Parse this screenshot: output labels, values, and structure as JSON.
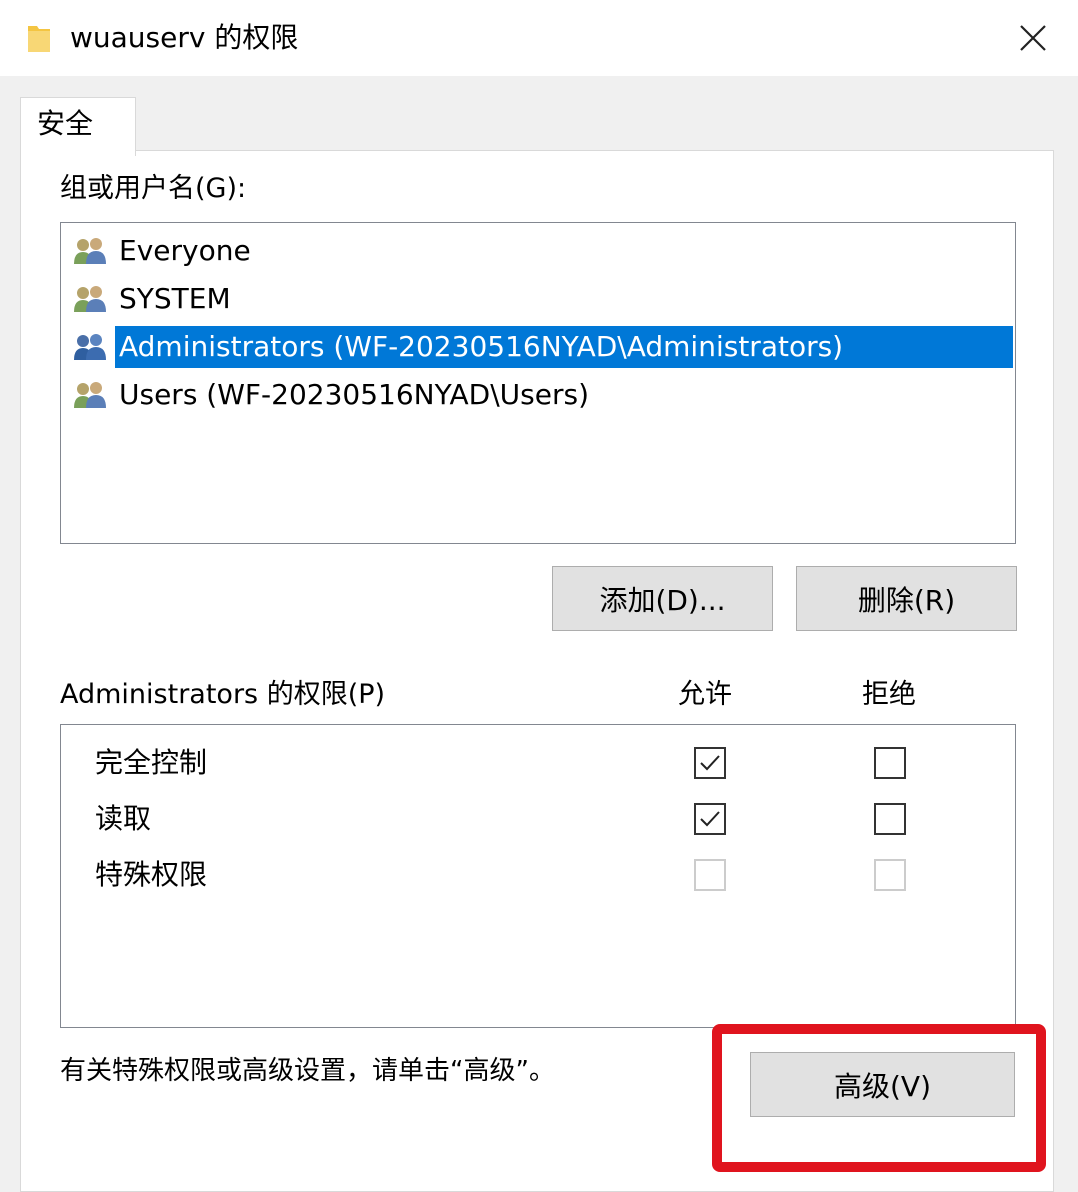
{
  "window": {
    "title": "wuauserv 的权限",
    "close_glyph": "✕",
    "folder_icon": "folder-icon"
  },
  "tabs": [
    {
      "label": "安全",
      "active": true
    }
  ],
  "users_section": {
    "label": "组或用户名(G):",
    "items": [
      {
        "label": "Everyone",
        "icon": "user-group-icon",
        "selected": false
      },
      {
        "label": "SYSTEM",
        "icon": "user-group-icon",
        "selected": false
      },
      {
        "label": "Administrators (WF-20230516NYAD\\Administrators)",
        "icon": "user-group-icon",
        "selected": true
      },
      {
        "label": "Users (WF-20230516NYAD\\Users)",
        "icon": "user-group-icon",
        "selected": false
      }
    ],
    "add_button": "添加(D)...",
    "remove_button": "删除(R)"
  },
  "permissions": {
    "label": "Administrators 的权限(P)",
    "allow_header": "允许",
    "deny_header": "拒绝",
    "rows": [
      {
        "name": "完全控制",
        "allow": true,
        "deny": false,
        "enabled": true
      },
      {
        "name": "读取",
        "allow": true,
        "deny": false,
        "enabled": true
      },
      {
        "name": "特殊权限",
        "allow": false,
        "deny": false,
        "enabled": false
      }
    ]
  },
  "footer": {
    "hint": "有关特殊权限或高级设置，请单击“高级”。",
    "advanced_button": "高级(V)"
  },
  "colors": {
    "selection": "#0078d7",
    "highlight_annotation": "#e0141e"
  }
}
